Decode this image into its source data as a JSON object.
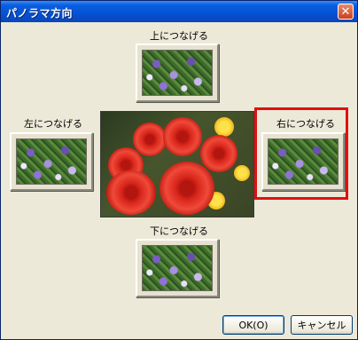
{
  "window": {
    "title": "パノラマ方向",
    "close_label": "✕"
  },
  "directions": {
    "top": "上につなげる",
    "left": "左につなげる",
    "right": "右につなげる",
    "bottom": "下につなげる"
  },
  "buttons": {
    "ok": "OK(O)",
    "cancel": "キャンセル"
  },
  "colors": {
    "highlight": "#e01010",
    "titlebar": "#0551d4"
  }
}
